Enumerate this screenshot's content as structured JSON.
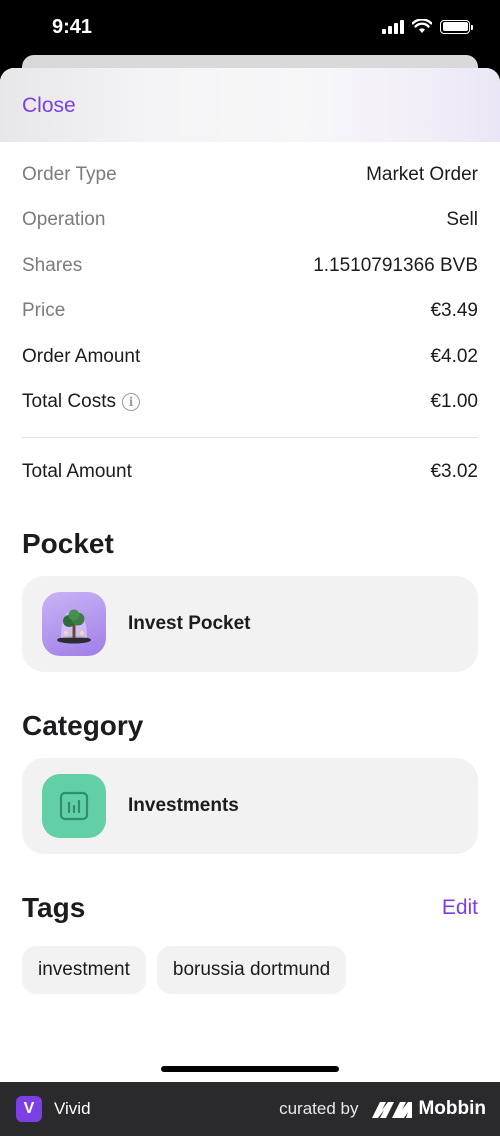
{
  "status_bar": {
    "time": "9:41"
  },
  "header": {
    "close_label": "Close"
  },
  "details": [
    {
      "label": "Order Type",
      "value": "Market Order",
      "emphasis": false
    },
    {
      "label": "Operation",
      "value": "Sell",
      "emphasis": false
    },
    {
      "label": "Shares",
      "value": "1.1510791366 BVB",
      "emphasis": false
    },
    {
      "label": "Price",
      "value": "€3.49",
      "emphasis": false
    },
    {
      "label": "Order Amount",
      "value": "€4.02",
      "emphasis": true
    },
    {
      "label": "Total Costs",
      "value": "€1.00",
      "emphasis": true
    }
  ],
  "total": {
    "label": "Total Amount",
    "value": "€3.02"
  },
  "pocket": {
    "title": "Pocket",
    "name": "Invest Pocket",
    "icon": "pocket-tree-icon"
  },
  "category": {
    "title": "Category",
    "name": "Investments",
    "icon": "chart-icon",
    "color": "#62cfa6"
  },
  "tags": {
    "title": "Tags",
    "edit_label": "Edit",
    "items": [
      "investment",
      "borussia dortmund"
    ]
  },
  "footer": {
    "app_name": "Vivid",
    "logo_letter": "V",
    "curated_by": "curated by",
    "brand": "Mobbin"
  },
  "colors": {
    "accent": "#7b3fe4",
    "footer_bg": "#2a2a2c"
  }
}
